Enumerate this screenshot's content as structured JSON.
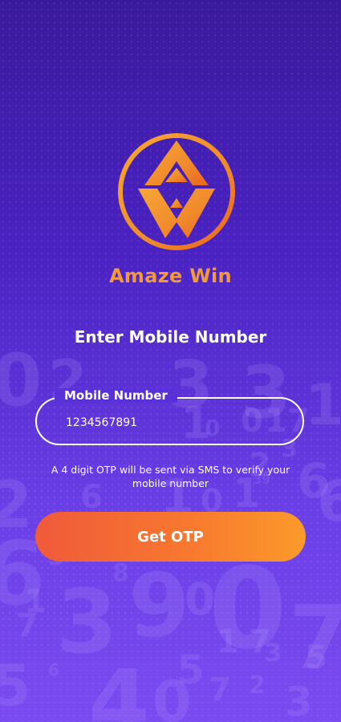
{
  "app": {
    "brand_name": "Amaze Win",
    "logo_icon": "amaze-win-logo-icon",
    "colors": {
      "background_top": "#3a1a9c",
      "background_bottom": "#7a4bf0",
      "brand_orange": "#f29a3a",
      "button_start": "#f05a3b",
      "button_end": "#fb9a2a"
    }
  },
  "login": {
    "heading": "Enter Mobile Number",
    "mobile_label": "Mobile Number",
    "mobile_value": "1234567891",
    "otp_note": "A 4 digit OTP will be sent via SMS to verify your mobile number",
    "submit_label": "Get OTP"
  }
}
